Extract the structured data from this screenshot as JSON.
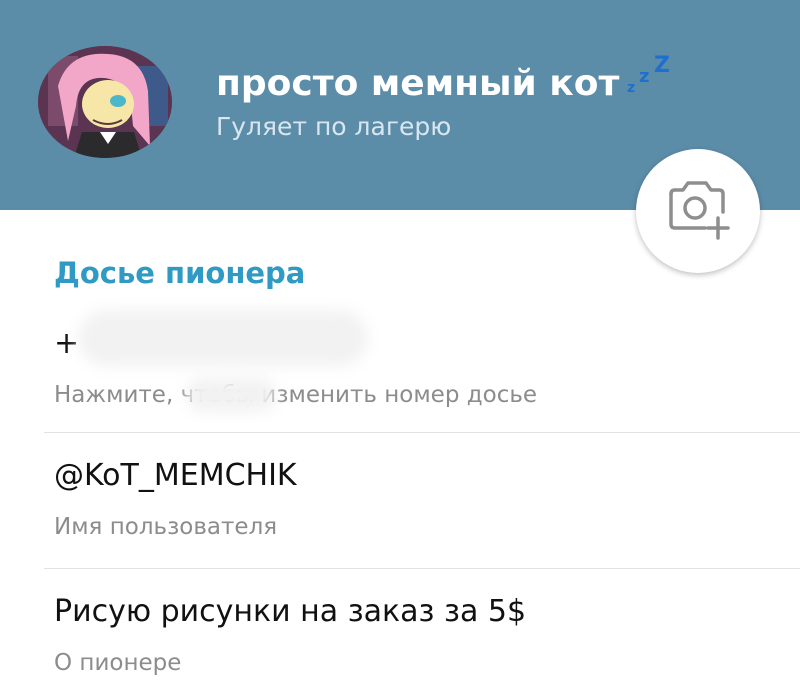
{
  "profile": {
    "name": "просто мемный кот",
    "status": "Гуляет по лагерю",
    "status_icon": "sleep-zzz-icon",
    "camera_icon": "add-photo-icon"
  },
  "section": {
    "title": "Досье пионера"
  },
  "rows": [
    {
      "value": "+",
      "caption": "Нажмите, чтобы изменить номер досье"
    },
    {
      "value": "@KoT_MEMCHIK",
      "caption": "Имя пользователя"
    },
    {
      "value": "Рисую рисунки на заказ за 5$",
      "caption": "О пионере"
    }
  ],
  "colors": {
    "header": "#5b8da9",
    "accent": "#2f9ac3",
    "zzz": "#1e6fd0"
  }
}
